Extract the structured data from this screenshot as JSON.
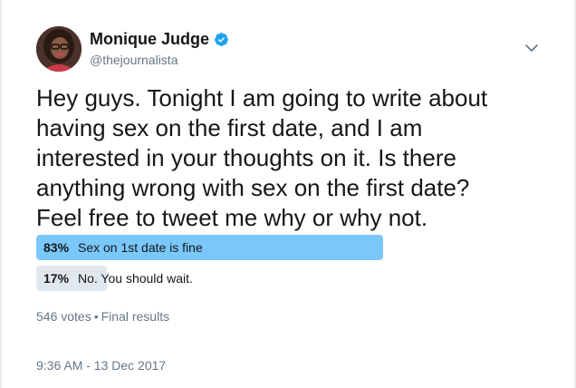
{
  "author": {
    "name": "Monique Judge",
    "handle": "@thejournalista",
    "verified": true
  },
  "tweet": {
    "text": "Hey guys. Tonight I am going to write about\nhaving sex on the first date, and I am\ninterested in your thoughts on it. Is there\nanything wrong with sex on the first date?\nFeel free to tweet me why or why not."
  },
  "poll": {
    "options": [
      {
        "percent_label": "83%",
        "label": "Sex on 1st date is fine",
        "percent": 83,
        "color": "#7ac7fa",
        "leading": true
      },
      {
        "percent_label": "17%",
        "label": "No. You should wait.",
        "percent": 17,
        "color": "#e1e8ed",
        "leading": false
      }
    ],
    "votes": "546 votes",
    "separator": "•",
    "status": "Final results"
  },
  "timestamp": "9:36 AM - 13 Dec 2017",
  "icons": {
    "verified": "verified-badge-icon",
    "menu": "chevron-down-icon"
  },
  "colors": {
    "verified_blue": "#1da1f2",
    "muted_text": "#657786"
  }
}
